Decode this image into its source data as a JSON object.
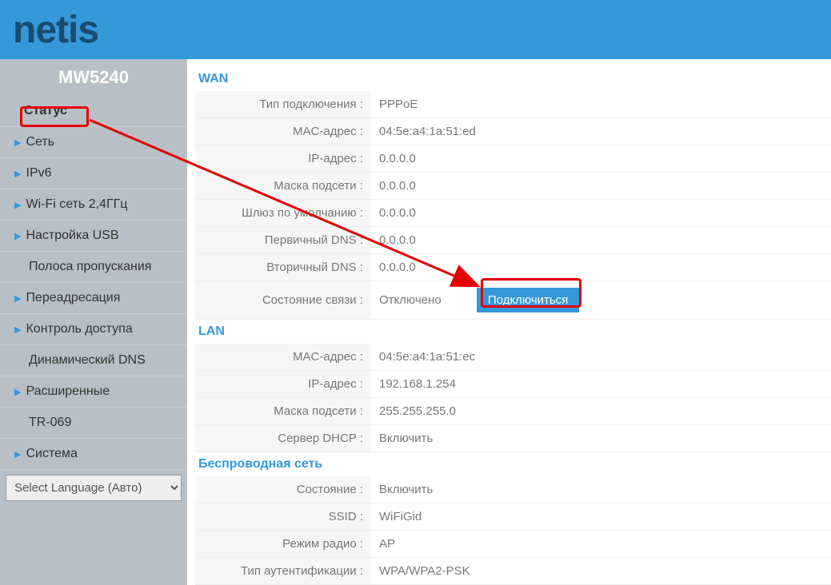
{
  "logo_text": "netis",
  "model": "MW5240",
  "sidebar": {
    "items": [
      {
        "label": "Статус",
        "active": true,
        "arrow": false
      },
      {
        "label": "Сеть",
        "arrow": true
      },
      {
        "label": "IPv6",
        "arrow": true
      },
      {
        "label": "Wi-Fi сеть 2,4ГГц",
        "arrow": true
      },
      {
        "label": "Настройка USB",
        "arrow": true
      },
      {
        "label": "Полоса пропускания",
        "arrow": false
      },
      {
        "label": "Переадресация",
        "arrow": true
      },
      {
        "label": "Контроль доступа",
        "arrow": true
      },
      {
        "label": "Динамический DNS",
        "arrow": false
      },
      {
        "label": "Расширенные",
        "arrow": true
      },
      {
        "label": "TR-069",
        "arrow": false
      },
      {
        "label": "Система",
        "arrow": true
      }
    ],
    "language_placeholder": "Select Language (Авто)"
  },
  "wan": {
    "title": "WAN",
    "rows": [
      {
        "label": "Тип подключения :",
        "value": "PPPoE"
      },
      {
        "label": "MAC-адрес :",
        "value": "04:5e:a4:1a:51:ed"
      },
      {
        "label": "IP-адрес :",
        "value": "0.0.0.0"
      },
      {
        "label": "Маска подсети :",
        "value": "0.0.0.0"
      },
      {
        "label": "Шлюз по умолчанию :",
        "value": "0.0.0.0"
      },
      {
        "label": "Первичный DNS :",
        "value": "0.0.0.0"
      },
      {
        "label": "Вторичный DNS :",
        "value": "0.0.0.0"
      }
    ],
    "connection_label": "Состояние связи :",
    "connection_status": "Отключено",
    "connect_button": "Подключиться"
  },
  "lan": {
    "title": "LAN",
    "rows": [
      {
        "label": "MAC-адрес :",
        "value": "04:5e:a4:1a:51:ec"
      },
      {
        "label": "IP-адрес :",
        "value": "192.168.1.254"
      },
      {
        "label": "Маска подсети :",
        "value": "255.255.255.0"
      },
      {
        "label": "Сервер DHCP :",
        "value": "Включить"
      }
    ]
  },
  "wireless": {
    "title": "Беспроводная сеть",
    "rows": [
      {
        "label": "Состояние :",
        "value": "Включить"
      },
      {
        "label": "SSID :",
        "value": "WiFiGid"
      },
      {
        "label": "Режим радио :",
        "value": "AP"
      },
      {
        "label": "Тип аутентификации :",
        "value": "WPA/WPA2-PSK"
      }
    ]
  }
}
